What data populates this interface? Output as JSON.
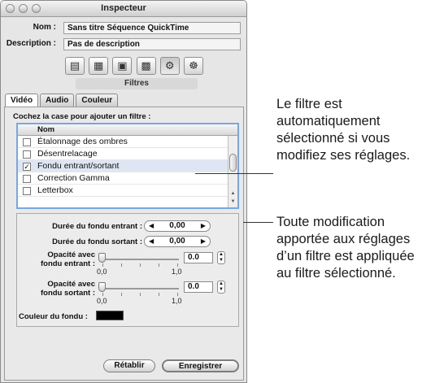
{
  "window": {
    "title": "Inspecteur"
  },
  "info": {
    "name_label": "Nom :",
    "name_value": "Sans titre Séquence QuickTime",
    "description_label": "Description :",
    "description_value": "Pas de description"
  },
  "toolbar": {
    "icons": [
      "general-icon",
      "video-settings-icon",
      "photo-icon",
      "layers-icon",
      "filters-icon",
      "gear-icon"
    ],
    "selected_index": 4,
    "section_label": "Filtres"
  },
  "tabs": [
    {
      "label": "Vidéo",
      "active": true
    },
    {
      "label": "Audio",
      "active": false
    },
    {
      "label": "Couleur",
      "active": false
    }
  ],
  "filters": {
    "hint": "Cochez la case pour ajouter un filtre :",
    "column_header": "Nom",
    "items": [
      {
        "label": "Étalonnage des ombres",
        "checked": false
      },
      {
        "label": "Désentrelacage",
        "checked": false
      },
      {
        "label": "Fondu entrant/sortant",
        "checked": true,
        "selected": true
      },
      {
        "label": "Correction Gamma",
        "checked": false
      },
      {
        "label": "Letterbox",
        "checked": false
      }
    ]
  },
  "params": {
    "fade_in_label": "Durée du fondu entrant :",
    "fade_in_value": "0,00",
    "fade_out_label": "Durée du fondu sortant :",
    "fade_out_value": "0,00",
    "opacity_in_label_1": "Opacité avec",
    "opacity_in_label_2": "fondu entrant :",
    "opacity_in_value": "0.0",
    "opacity_out_label_1": "Opacité avec",
    "opacity_out_label_2": "fondu sortant :",
    "opacity_out_value": "0.0",
    "slider_min": "0,0",
    "slider_max": "1,0",
    "fade_color_label": "Couleur du fondu :",
    "fade_color": "#000000"
  },
  "buttons": {
    "revert": "Rétablir",
    "save": "Enregistrer"
  },
  "annotations": {
    "top": [
      "Le filtre est",
      "automatiquement",
      "sélectionné si vous",
      "modifiez ses réglages."
    ],
    "bottom": [
      "Toute modification",
      "apportée aux réglages",
      "d’un filtre est appliquée",
      "au filtre sélectionné."
    ]
  }
}
